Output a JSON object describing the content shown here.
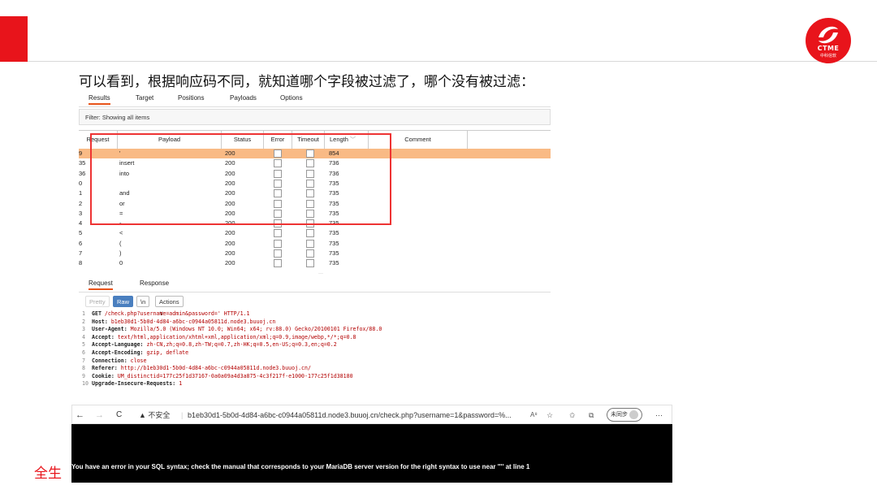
{
  "slide": {
    "heading": "可以看到，根据响应码不同，就知道哪个字段被过滤了，哪个没有被过滤：",
    "footer": "全生",
    "logo_text": "CTME",
    "logo_sub": "中科信软",
    "accent": "#e8141b"
  },
  "burp": {
    "tabs": [
      "Results",
      "Target",
      "Positions",
      "Payloads",
      "Options"
    ],
    "filter": "Filter: Showing all items",
    "columns": [
      "Request",
      "Payload",
      "Status",
      "Error",
      "Timeout",
      "Length",
      "Comment"
    ],
    "sort_icon": "chevron-down-icon",
    "rows": [
      {
        "req": "9",
        "payload": "'",
        "status": "200",
        "length": "854"
      },
      {
        "req": "35",
        "payload": "insert",
        "status": "200",
        "length": "736"
      },
      {
        "req": "36",
        "payload": "into",
        "status": "200",
        "length": "736"
      },
      {
        "req": "0",
        "payload": "",
        "status": "200",
        "length": "735"
      },
      {
        "req": "1",
        "payload": "and",
        "status": "200",
        "length": "735"
      },
      {
        "req": "2",
        "payload": "or",
        "status": "200",
        "length": "735"
      },
      {
        "req": "3",
        "payload": "=",
        "status": "200",
        "length": "735"
      },
      {
        "req": "4",
        "payload": "-",
        "status": "200",
        "length": "735"
      },
      {
        "req": "5",
        "payload": "<",
        "status": "200",
        "length": "735"
      },
      {
        "req": "6",
        "payload": "(",
        "status": "200",
        "length": "735"
      },
      {
        "req": "7",
        "payload": ")",
        "status": "200",
        "length": "735"
      },
      {
        "req": "8",
        "payload": "0",
        "status": "200",
        "length": "735"
      }
    ],
    "split_grip": "···",
    "editor_tabs": [
      "Request",
      "Response"
    ],
    "editor_buttons": {
      "pretty": "Pretty",
      "raw": "Raw",
      "newline": "\\n",
      "actions": "Actions"
    },
    "request_lines": [
      {
        "n": "1",
        "key": "GET",
        "value": " /check.php?username=admin&password=' HTTP/1.1"
      },
      {
        "n": "2",
        "key": "Host:",
        "value": " b1eb30d1-5b0d-4d84-a6bc-c0944a05811d.node3.buuoj.cn"
      },
      {
        "n": "3",
        "key": "User-Agent:",
        "value": " Mozilla/5.0 (Windows NT 10.0; Win64; x64; rv:88.0) Gecko/20100101 Firefox/88.0"
      },
      {
        "n": "4",
        "key": "Accept:",
        "value": " text/html,application/xhtml+xml,application/xml;q=0.9,image/webp,*/*;q=0.8"
      },
      {
        "n": "5",
        "key": "Accept-Language:",
        "value": " zh-CN,zh;q=0.8,zh-TW;q=0.7,zh-HK;q=0.5,en-US;q=0.3,en;q=0.2"
      },
      {
        "n": "6",
        "key": "Accept-Encoding:",
        "value": " gzip, deflate"
      },
      {
        "n": "7",
        "key": "Connection:",
        "value": " close"
      },
      {
        "n": "8",
        "key": "Referer:",
        "value": " http://b1eb30d1-5b0d-4d84-a6bc-c0944a05811d.node3.buuoj.cn/"
      },
      {
        "n": "9",
        "key": "Cookie:",
        "value": " UM_distinctid=177c25f1d37167-0a0a09a4d3a875-4c3f217f-e1000-177c25f1d38180"
      },
      {
        "n": "10",
        "key": "Upgrade-Insecure-Requests:",
        "value": " 1"
      }
    ]
  },
  "browser": {
    "back": "←",
    "forward": "→",
    "reload": "C",
    "insecure": "▲ 不安全",
    "url": "b1eb30d1-5b0d-4d84-a6bc-c0944a05811d.node3.buuoj.cn/check.php?username=1&password=%...",
    "read_aloud": "A⁸",
    "profile": "未同步",
    "more": "···",
    "error": "You have an error in your SQL syntax; check the manual that corresponds to your MariaDB server version for the right syntax to use near '''' at line 1"
  }
}
